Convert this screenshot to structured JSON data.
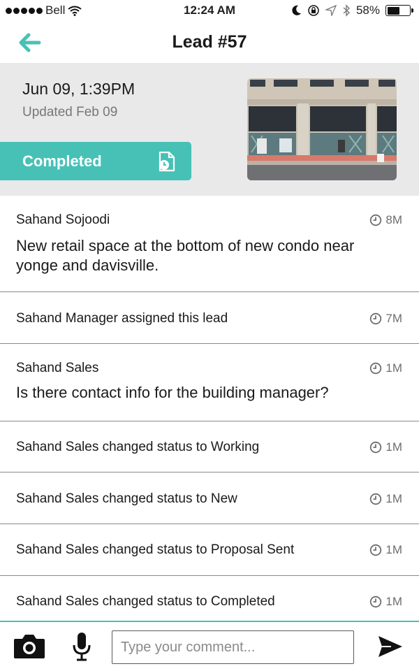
{
  "status_bar": {
    "carrier": "Bell",
    "time": "12:24 AM",
    "battery_label": "58%",
    "battery_level": 0.58,
    "icons": [
      "signal-dots-icon",
      "wifi-icon",
      "moon-icon",
      "orientation-lock-icon",
      "location-arrow-icon",
      "bluetooth-icon",
      "battery-icon"
    ]
  },
  "nav": {
    "title": "Lead #57",
    "back_icon": "arrow-left-icon"
  },
  "lead": {
    "date": "Jun 09, 1:39PM",
    "updated": "Updated Feb 09",
    "status_label": "Completed",
    "status_icon": "document-clock-icon",
    "photo": "building-storefront-photo"
  },
  "feed": [
    {
      "type": "comment",
      "author": "Sahand Sojoodi",
      "text": "New retail space at the bottom of new condo near yonge and davisville.",
      "time": "8M"
    },
    {
      "type": "event",
      "text": "Sahand Manager assigned this lead",
      "time": "7M"
    },
    {
      "type": "comment",
      "author": "Sahand Sales",
      "text": "Is there contact info for the building manager?",
      "time": "1M"
    },
    {
      "type": "event",
      "text": "Sahand Sales changed status to Working",
      "time": "1M"
    },
    {
      "type": "event",
      "text": "Sahand Sales changed status to New",
      "time": "1M"
    },
    {
      "type": "event",
      "text": "Sahand Sales changed status to Proposal Sent",
      "time": "1M"
    },
    {
      "type": "event",
      "text": "Sahand Sales changed status to Completed",
      "time": "1M"
    }
  ],
  "composer": {
    "placeholder": "Type your comment...",
    "camera_icon": "camera-icon",
    "mic_icon": "microphone-icon",
    "send_icon": "send-icon"
  },
  "colors": {
    "accent": "#47c1b6",
    "header_bg": "#e9e9e9",
    "divider": "#8a8a8a",
    "muted_text": "#777777"
  }
}
